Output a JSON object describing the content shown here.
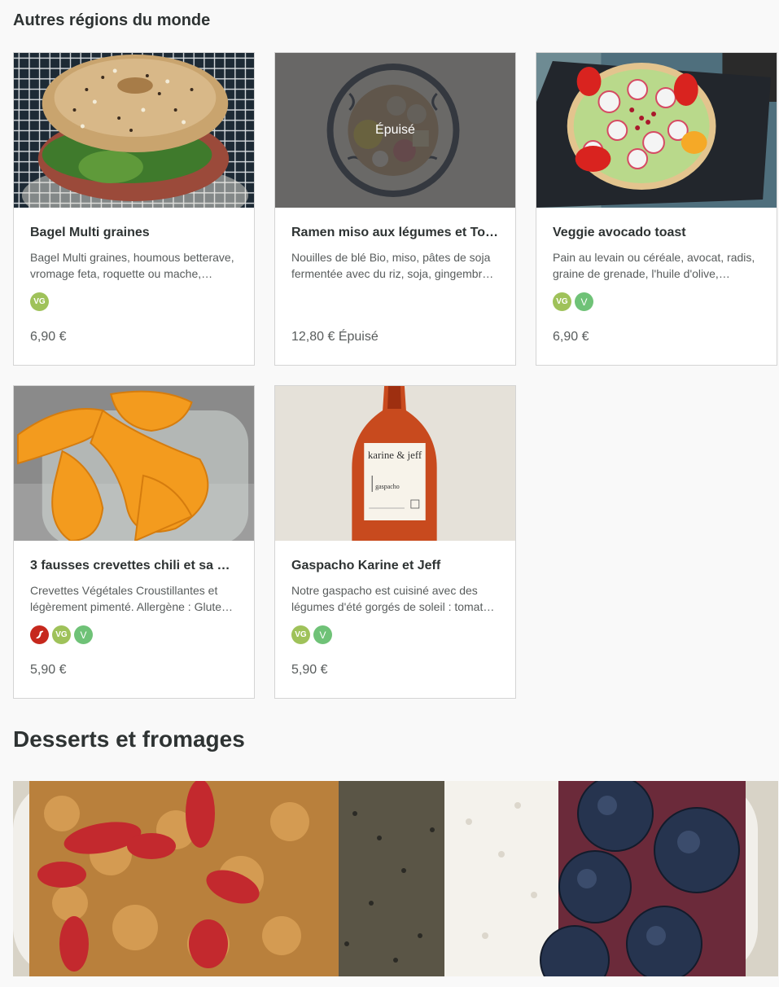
{
  "sections": [
    {
      "title": "Autres régions du monde"
    },
    {
      "title": "Desserts et fromages"
    }
  ],
  "items": [
    {
      "name": "Bagel Multi graines",
      "description": "Bagel Multi graines, houmous betterave, vromage feta, roquette ou mache,…",
      "price": "6,90 €",
      "badges": [
        "VG"
      ],
      "sold_out": false
    },
    {
      "name": "Ramen miso aux légumes et To…",
      "description": "Nouilles de blé Bio, miso, pâtes de soja fermentée avec du riz, soja, gingembr…",
      "price": "12,80 € Épuisé",
      "badges": [],
      "sold_out": true,
      "sold_out_label": "Épuisé"
    },
    {
      "name": "Veggie avocado toast",
      "description": "Pain au levain ou céréale, avocat, radis, graine de grenade, l'huile d'olive,…",
      "price": "6,90 €",
      "badges": [
        "VG",
        "V"
      ],
      "sold_out": false
    },
    {
      "name": "3 fausses crevettes chili et sa …",
      "description": "Crevettes Végétales Croustillantes et légèrement pimenté. Allergène : Glute…",
      "price": "5,90 €",
      "badges": [
        "chili",
        "VG",
        "V"
      ],
      "sold_out": false
    },
    {
      "name": "Gaspacho Karine et Jeff",
      "description": "Notre gaspacho est cuisiné avec des légumes d'été gorgés de soleil : tomat…",
      "price": "5,90 €",
      "badges": [
        "VG",
        "V"
      ],
      "sold_out": false
    }
  ],
  "bottle_label": {
    "brand": "karine & jeff",
    "product": "gaspacho"
  },
  "badge_labels": {
    "vg": "VG",
    "v": "V"
  },
  "colors": {
    "vg_badge": "#9fc25a",
    "v_badge": "#6fc277",
    "chili_badge": "#c6281d"
  }
}
